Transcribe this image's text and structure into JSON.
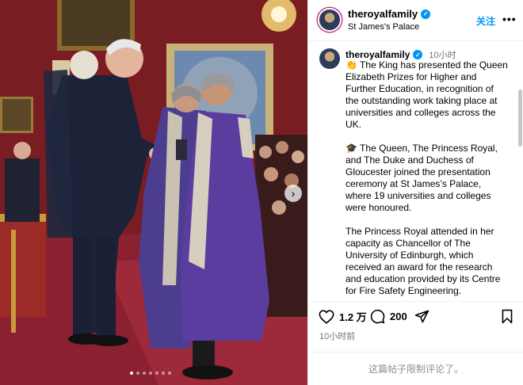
{
  "post": {
    "username": "theroyalfamily",
    "location": "St James's Palace",
    "follow_label": "关注",
    "more_label": "•••",
    "time_ago": "10小时",
    "caption": [
      "👏 The King has presented the Queen Elizabeth Prizes for Higher and Further Education, in recognition of the outstanding work taking place at universities and colleges across the UK.",
      "🎓 The Queen, The Princess Royal, and The Duke and Duchess of Gloucester joined the presentation ceremony at St James’s Palace, where 19 universities and colleges were honoured.",
      "The Princess Royal attended in her capacity as Chancellor of The University of Edinburgh, which received an award for the research and education provided by its Centre for Fire Safety Engineering."
    ],
    "likes": "1.2 万",
    "comments": "200",
    "posted_ago": "10小时前",
    "comments_limited": "这篇帖子限制评论了。"
  },
  "carousel": {
    "next_label": "›",
    "slide_count": 7,
    "active_index": 0
  },
  "icons": {
    "verified": "verified-badge-icon",
    "like": "heart-icon",
    "comment": "comment-bubble-icon",
    "share": "paper-plane-icon",
    "save": "bookmark-icon",
    "next": "chevron-right-icon"
  },
  "colors": {
    "accent": "#0095f6",
    "muted": "#737373",
    "room_red": "#7a1d22"
  }
}
